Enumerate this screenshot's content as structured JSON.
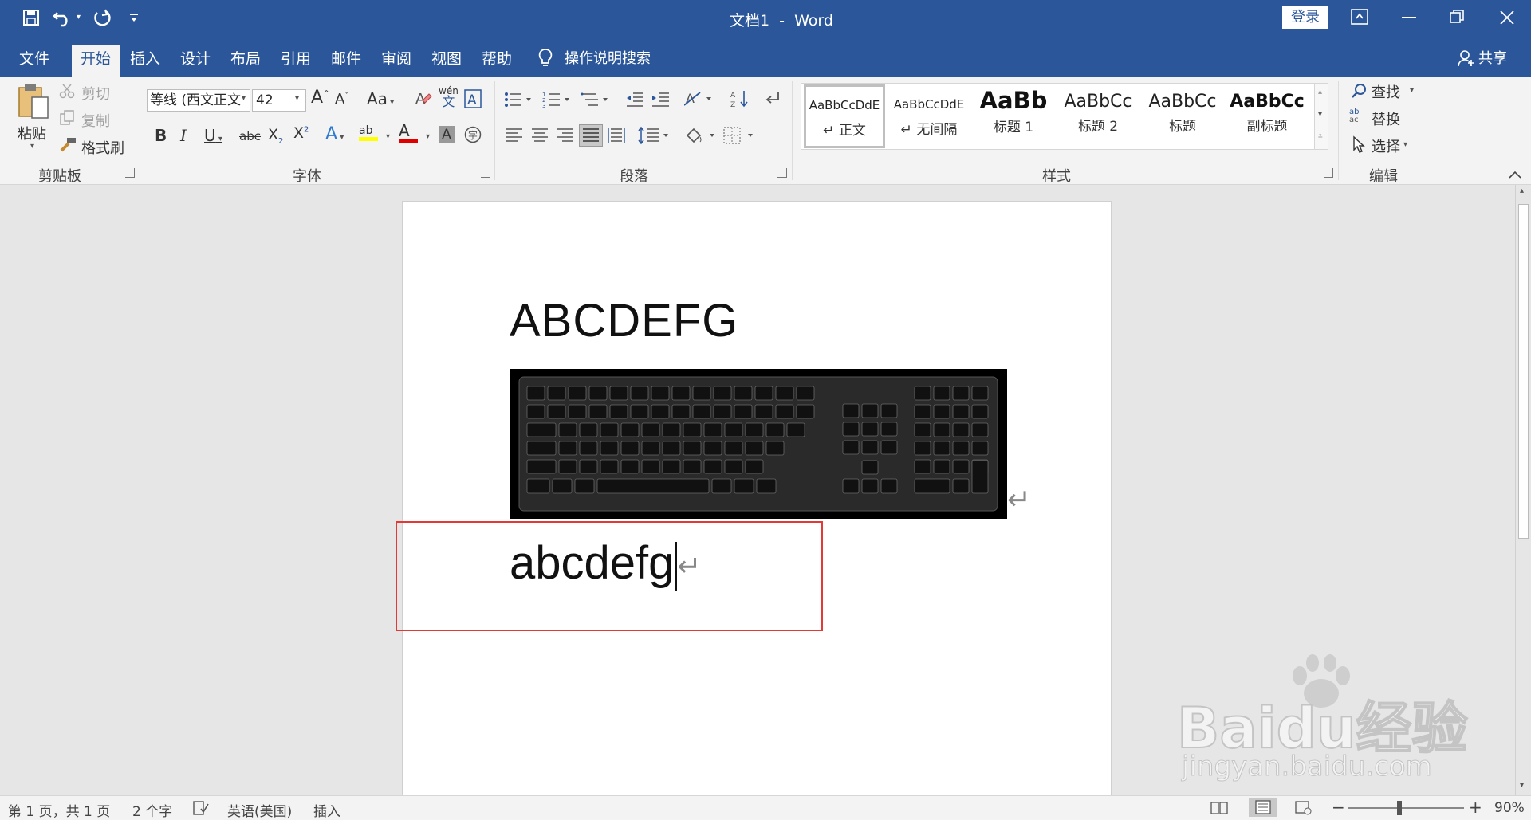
{
  "window": {
    "title": "文档1  -  Word",
    "login_label": "登录"
  },
  "tabs": [
    {
      "label": "文件"
    },
    {
      "label": "开始"
    },
    {
      "label": "插入"
    },
    {
      "label": "设计"
    },
    {
      "label": "布局"
    },
    {
      "label": "引用"
    },
    {
      "label": "邮件"
    },
    {
      "label": "审阅"
    },
    {
      "label": "视图"
    },
    {
      "label": "帮助"
    }
  ],
  "active_tab": "开始",
  "search_tell": "操作说明搜索",
  "share_label": "共享",
  "clipboard": {
    "paste": "粘贴",
    "cut": "剪切",
    "copy": "复制",
    "format_painter": "格式刷",
    "group": "剪贴板"
  },
  "font": {
    "name": "等线 (西文正文",
    "size": "42",
    "case_label": "Aa",
    "phonetic_top": "wén",
    "phonetic_bottom": "文",
    "group": "字体"
  },
  "paragraph": {
    "group": "段落"
  },
  "styles": {
    "items": [
      {
        "preview": "AaBbCcDdE",
        "name": "正文"
      },
      {
        "preview": "AaBbCcDdE",
        "name": "无间隔"
      },
      {
        "preview": "AaBb",
        "name": "标题 1"
      },
      {
        "preview": "AaBbCc",
        "name": "标题 2"
      },
      {
        "preview": "AaBbCc",
        "name": "标题"
      },
      {
        "preview": "AaBbCc",
        "name": "副标题"
      }
    ],
    "group": "样式"
  },
  "editing": {
    "find": "查找",
    "replace": "替换",
    "select": "选择",
    "group": "编辑"
  },
  "document": {
    "heading_text": "ABCDEFG",
    "body_text": "abcdefg"
  },
  "keyboard_image_desc": "keyboard photo",
  "status": {
    "page": "第 1 页，共 1 页",
    "words": "2 个字",
    "language": "英语(美国)",
    "mode": "插入",
    "zoom": "90%"
  },
  "watermark": {
    "brand": "Baidu经验",
    "url": "jingyan.baidu.com"
  },
  "colors": {
    "accent": "#2b579a",
    "highlight_box": "#e53935"
  }
}
